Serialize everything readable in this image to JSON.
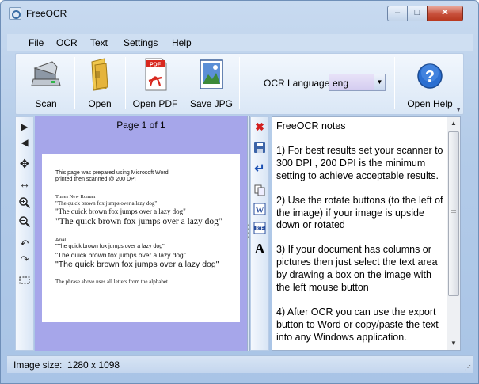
{
  "window": {
    "title": "FreeOCR"
  },
  "title_buttons": {
    "minimize": "–",
    "maximize": "□",
    "close": "✕"
  },
  "menu": [
    "File",
    "OCR",
    "Text",
    "Settings",
    "Help"
  ],
  "toolbar": {
    "scan": "Scan",
    "open": "Open",
    "open_pdf": "Open PDF",
    "save_jpg": "Save JPG",
    "ocr_language_label": "OCR Language:",
    "ocr_language_value": "eng",
    "open_help": "Open Help",
    "pdf_badge": "PDF",
    "help_glyph": "?"
  },
  "image_pane": {
    "page_info": "Page 1 of 1",
    "document_lines": [
      "This page was prepared using Microsoft Word",
      "printed then scanned @ 200 DPI",
      "Times New Roman",
      "\"The quick brown fox jumps over a lazy dog\"",
      "\"The quick brown fox jumps over a lazy dog\"",
      "\"The quick brown fox jumps over a lazy dog\"",
      "Arial",
      "\"The quick brown fox jumps over a lazy dog\"",
      "\"The quick brown fox  jumps over a lazy dog\"",
      "\"The quick brown fox jumps over a lazy dog\"",
      "The phrase above uses all letters from the alphabet."
    ]
  },
  "text_pane": {
    "title": "FreeOCR notes",
    "paragraphs": [
      "1) For best results set your scanner to 300 DPI , 200 DPI is the minimum setting to achieve acceptable results.",
      "2) Use the rotate buttons (to the left of the image) if your image is upside down or rotated",
      "3) If your document has columns or pictures then just select the text area by drawing a box on the image with the left mouse button",
      "4) After OCR you can use the export button to Word or copy/paste the text into any Windows application."
    ]
  },
  "status": {
    "label": "Image size:",
    "value": "1280 x 1098"
  },
  "icons": [
    "app-icon",
    "scan-icon",
    "folder-icon",
    "pdf-icon",
    "jpg-icon",
    "help-icon",
    "next-icon",
    "prev-icon",
    "move-icon",
    "fit-width-icon",
    "zoom-in-icon",
    "zoom-out-icon",
    "rotate-left-icon",
    "rotate-right-icon",
    "select-area-icon",
    "clear-icon",
    "save-icon",
    "enter-icon",
    "copy-icon",
    "word-icon",
    "rtf-icon",
    "font-icon"
  ],
  "colors": {
    "image_pane_bg": "#a6a6ea",
    "window_bg": "#b3cbe8"
  }
}
